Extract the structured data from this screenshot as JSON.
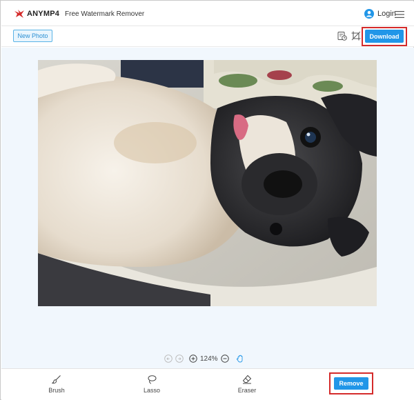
{
  "header": {
    "brand": "ANYMP4",
    "app_title": "Free Watermark Remover",
    "login_label": "Login",
    "icons": {
      "logo": "anymp4-logo-icon",
      "user": "user-icon",
      "menu": "hamburger-menu-icon"
    }
  },
  "toolbar": {
    "new_photo_label": "New Photo",
    "download_label": "Download",
    "icons": [
      "history-icon",
      "crop-icon"
    ]
  },
  "canvas": {
    "image_description_icon": "photo-dog-icon",
    "zoom_level": "124%",
    "icons": [
      "undo-icon",
      "redo-icon",
      "zoom-in-icon",
      "zoom-out-icon",
      "hand-pan-icon"
    ]
  },
  "tools": {
    "brush_label": "Brush",
    "lasso_label": "Lasso",
    "eraser_label": "Eraser",
    "remove_label": "Remove"
  },
  "colors": {
    "accent": "#2196e8",
    "highlight": "#d42a2a",
    "canvas_bg": "#f1f7fd"
  }
}
